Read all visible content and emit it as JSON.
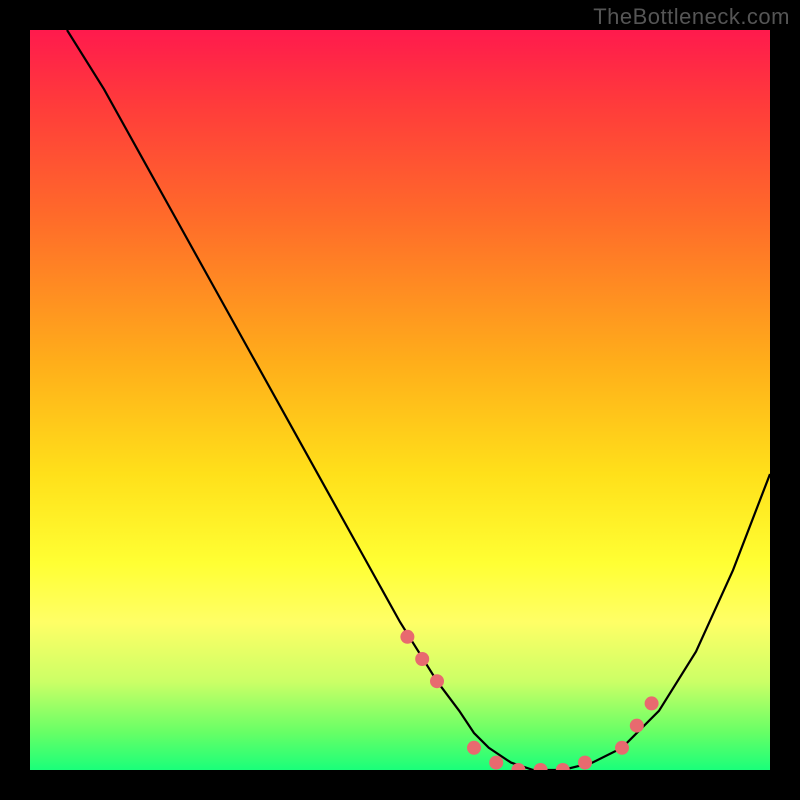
{
  "watermark": "TheBottleneck.com",
  "chart_data": {
    "type": "line",
    "title": "",
    "xlabel": "",
    "ylabel": "",
    "xlim": [
      0,
      100
    ],
    "ylim": [
      0,
      100
    ],
    "grid": false,
    "legend": false,
    "series": [
      {
        "name": "bottleneck-curve",
        "x": [
          5,
          10,
          15,
          20,
          25,
          30,
          35,
          40,
          45,
          50,
          55,
          58,
          60,
          62,
          65,
          68,
          72,
          76,
          80,
          85,
          90,
          95,
          100
        ],
        "y": [
          100,
          92,
          83,
          74,
          65,
          56,
          47,
          38,
          29,
          20,
          12,
          8,
          5,
          3,
          1,
          0,
          0,
          1,
          3,
          8,
          16,
          27,
          40
        ]
      }
    ],
    "markers": {
      "name": "highlight-points",
      "color": "#e86a6f",
      "x": [
        51,
        53,
        55,
        60,
        63,
        66,
        69,
        72,
        75,
        80,
        82,
        84
      ],
      "y": [
        18,
        15,
        12,
        3,
        1,
        0,
        0,
        0,
        1,
        3,
        6,
        9
      ]
    },
    "gradient_stops": [
      {
        "pos": 0,
        "color": "#ff1a4d"
      },
      {
        "pos": 10,
        "color": "#ff3b3b"
      },
      {
        "pos": 25,
        "color": "#ff6a2a"
      },
      {
        "pos": 45,
        "color": "#ffae1a"
      },
      {
        "pos": 60,
        "color": "#ffe01a"
      },
      {
        "pos": 72,
        "color": "#ffff33"
      },
      {
        "pos": 80,
        "color": "#ffff66"
      },
      {
        "pos": 88,
        "color": "#ccff66"
      },
      {
        "pos": 95,
        "color": "#66ff66"
      },
      {
        "pos": 100,
        "color": "#1aff7a"
      }
    ]
  }
}
